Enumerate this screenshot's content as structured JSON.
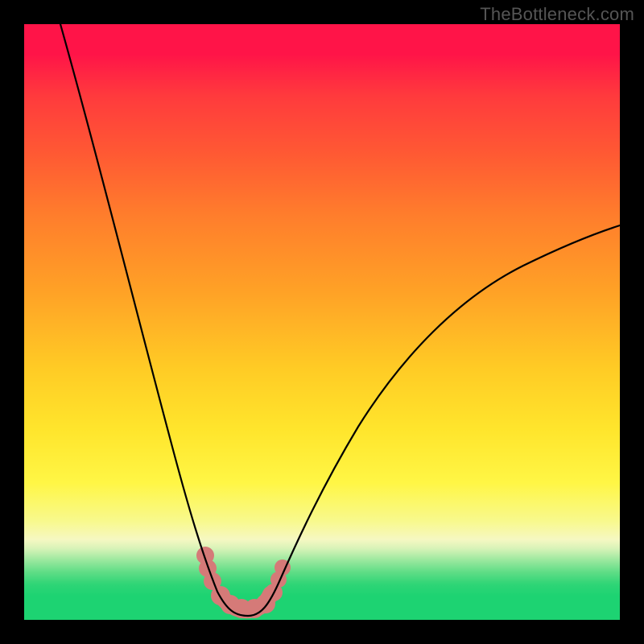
{
  "watermark": "TheBottleneck.com",
  "colors": {
    "frame": "#000000",
    "curve": "#000000",
    "trough_accent": "#d57a78",
    "gradient_top": "#ff1448",
    "gradient_bottom_green": "#1dd372"
  },
  "chart_data": {
    "type": "line",
    "title": "",
    "xlabel": "",
    "ylabel": "",
    "xlim": [
      0,
      100
    ],
    "ylim": [
      0,
      100
    ],
    "grid": false,
    "note": "No axis ticks or numeric labels are present in the image; values are geometric estimates on a 0-100 scale mapped to plot area width/height.",
    "series": [
      {
        "name": "bottleneck-curve",
        "x": [
          6,
          10,
          14,
          18,
          22,
          25,
          27.5,
          29.5,
          31,
          33,
          34.5,
          36.5,
          40,
          44,
          47,
          52,
          58,
          66,
          76,
          88,
          100
        ],
        "y": [
          100,
          86,
          71,
          56,
          42,
          30,
          21,
          14,
          8,
          3,
          1,
          1,
          3,
          8,
          14,
          23,
          32,
          42,
          51,
          59,
          64
        ]
      }
    ],
    "annotations": [
      {
        "name": "trough-highlight",
        "x_range": [
          30,
          42
        ],
        "y": 1,
        "description": "Salmon-colored beaded segment emphasizing the minimum of the curve near the bottom green band."
      }
    ]
  }
}
